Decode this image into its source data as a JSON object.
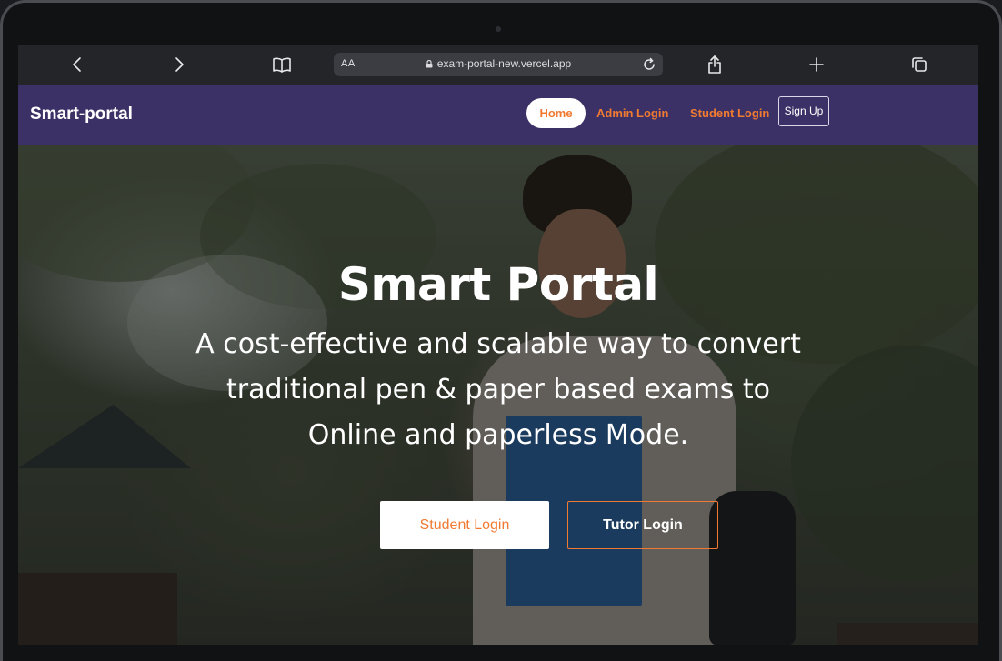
{
  "browser": {
    "text_size_label": "AA",
    "url": "exam-portal-new.vercel.app",
    "icons": [
      "back-icon",
      "forward-icon",
      "bookmarks-icon",
      "lock-icon",
      "reload-icon",
      "share-icon",
      "new-tab-icon",
      "tabs-icon"
    ]
  },
  "nav": {
    "brand": "Smart-portal",
    "home": "Home",
    "admin_login": "Admin Login",
    "student_login": "Student Login",
    "sign_up": "Sign Up"
  },
  "hero": {
    "title": "Smart Portal",
    "subtitle": "A cost-effective and scalable way to convert traditional pen & paper based exams to Online and paperless Mode.",
    "student_button": "Student Login",
    "tutor_button": "Tutor Login"
  },
  "colors": {
    "nav_bg": "#3b3166",
    "accent": "#f07a32",
    "toolbar_bg": "#232528"
  }
}
